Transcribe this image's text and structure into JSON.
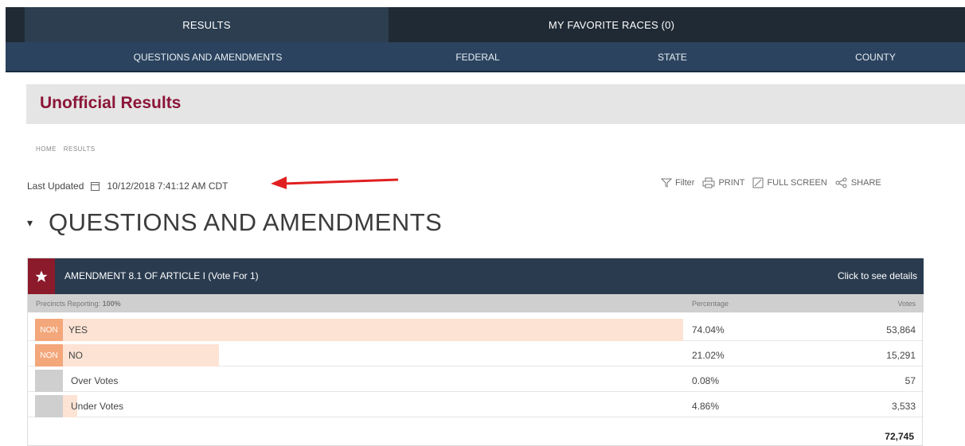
{
  "tabs": {
    "results": "RESULTS",
    "favorites": "MY FAVORITE RACES  (0)"
  },
  "subnav": [
    "QUESTIONS AND AMENDMENTS",
    "FEDERAL",
    "STATE",
    "COUNTY"
  ],
  "page_title": "Unofficial Results",
  "breadcrumb": [
    "HOME",
    "RESULTS"
  ],
  "last_updated": {
    "label": "Last Updated",
    "value": "10/12/2018 7:41:12 AM CDT"
  },
  "actions": {
    "filter": "Filter",
    "print": "PRINT",
    "fullscreen": "FULL SCREEN",
    "share": "SHARE"
  },
  "section_title": "QUESTIONS AND AMENDMENTS",
  "race": {
    "name": "AMENDMENT 8.1 OF ARTICLE I (Vote For 1)",
    "details_link": "Click to see details",
    "precincts_label": "Precincts Reporting:",
    "precincts_value": "100%",
    "col_percentage": "Percentage",
    "col_votes": "Votes",
    "rows": [
      {
        "badge": "NON",
        "name": "YES",
        "pct": "74.04%",
        "votes": "53,864",
        "share": 0.7404
      },
      {
        "badge": "NON",
        "name": "NO",
        "pct": "21.02%",
        "votes": "15,291",
        "share": 0.2102
      },
      {
        "badge": "",
        "name": "Over Votes",
        "pct": "0.08%",
        "votes": "57",
        "share": 0.0008
      },
      {
        "badge": "",
        "name": "Under Votes",
        "pct": "4.86%",
        "votes": "3,533",
        "share": 0.0486
      }
    ],
    "total": "72,745"
  },
  "colors": {
    "accent": "#8b1538",
    "nav_dark": "#1f2a35",
    "nav": "#2b435e",
    "bar": "#fde3d4",
    "badge": "#f3a77a",
    "arrow": "#e02020"
  }
}
